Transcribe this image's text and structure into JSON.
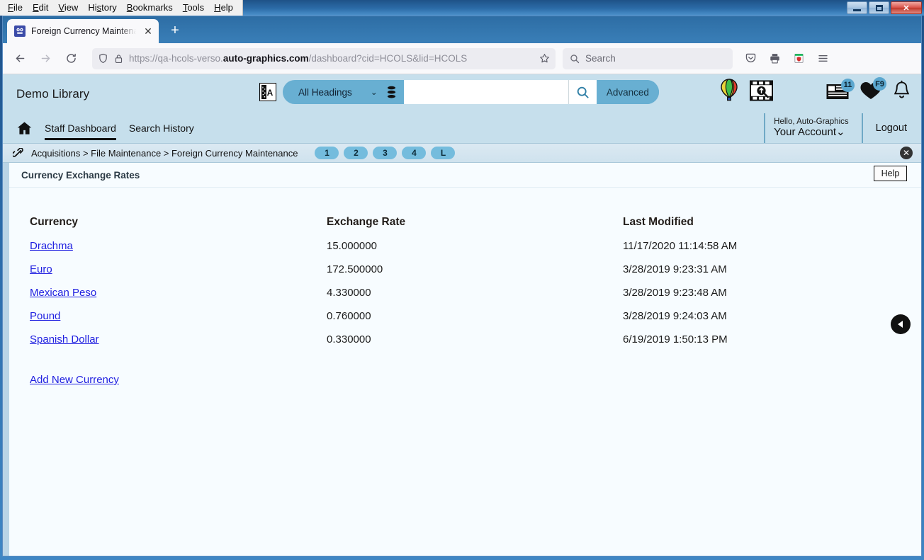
{
  "window": {
    "menus": [
      "File",
      "Edit",
      "View",
      "History",
      "Bookmarks",
      "Tools",
      "Help"
    ],
    "minimize_label": "Minimize",
    "maximize_label": "Maximize",
    "close_label": "✕"
  },
  "browser": {
    "tab": {
      "title": "Foreign Currency Maintenance",
      "close_label": "✕"
    },
    "new_tab_label": "+",
    "url_prefix": "https://qa-hcols-verso.",
    "url_domain": "auto-graphics.com",
    "url_suffix": "/dashboard?cid=HCOLS&lid=HCOLS",
    "search_placeholder": "Search"
  },
  "app": {
    "library_name": "Demo Library",
    "search": {
      "scope_label": "All Headings",
      "input_value": "",
      "advanced_label": "Advanced"
    },
    "header_badges": {
      "list_count": "11",
      "favorites_count": "F9"
    },
    "subnav": {
      "links": [
        {
          "label": "Staff Dashboard",
          "active": true
        },
        {
          "label": "Search History",
          "active": false
        }
      ],
      "hello": "Hello, Auto-Graphics",
      "account": "Your Account",
      "account_caret": "⌄",
      "logout": "Logout"
    },
    "breadcrumb": {
      "text": "Acquisitions > File Maintenance > Foreign Currency Maintenance",
      "steps": [
        "1",
        "2",
        "3",
        "4",
        "L"
      ],
      "close_label": "✕"
    },
    "panel": {
      "title": "Currency Exchange Rates",
      "help_label": "Help"
    },
    "table": {
      "headers": [
        "Currency",
        "Exchange Rate",
        "Last Modified"
      ],
      "rows": [
        {
          "currency": "Drachma",
          "rate": "15.000000",
          "modified": "11/17/2020 11:14:58 AM"
        },
        {
          "currency": "Euro",
          "rate": "172.500000",
          "modified": "3/28/2019 9:23:31 AM"
        },
        {
          "currency": "Mexican Peso",
          "rate": "4.330000",
          "modified": "3/28/2019 9:23:48 AM"
        },
        {
          "currency": "Pound",
          "rate": "0.760000",
          "modified": "3/28/2019 9:24:03 AM"
        },
        {
          "currency": "Spanish Dollar",
          "rate": "0.330000",
          "modified": "6/19/2019 1:50:13 PM"
        }
      ],
      "add_new_label": "Add New Currency"
    },
    "colors": {
      "header_blue": "#c6dfec",
      "accent_blue": "#68afd2",
      "link_blue": "#2020e0",
      "content_bg": "#f7fcff"
    }
  }
}
